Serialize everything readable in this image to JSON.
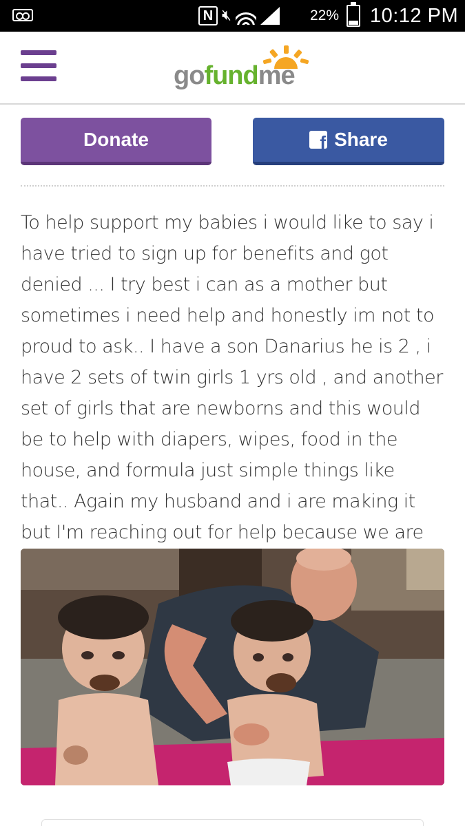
{
  "status_bar": {
    "battery_percent": "22%",
    "battery_level": 0.22,
    "time": "10:12 PM",
    "icons": [
      "voicemail-icon",
      "nfc-icon",
      "mute-icon",
      "wifi-icon",
      "signal-icon",
      "battery-charging-icon"
    ]
  },
  "header": {
    "menu_icon": "hamburger-menu-icon",
    "logo": {
      "go": "go",
      "fund": "fund",
      "me": "me"
    }
  },
  "actions": {
    "donate_label": "Donate",
    "share_label": "Share",
    "share_icon": "facebook-icon"
  },
  "story": {
    "text": "To help support my babies i would like to say i have tried to sign up for benefits and got denied ... I try best i can as a mother but sometimes i need help and honestly im not to proud to ask.. I have a son Danarius he is 2 , i have 2 sets of twin girls 1 yrs old , and another set of girls that are newborns and this would be to help with diapers, wipes, food in the house, and formula just simple things like that.. Again my husband and i are making it but I'm reaching out for help because we are not to good to ask"
  },
  "colors": {
    "brand_purple": "#7d519f",
    "facebook_blue": "#3a59a2",
    "logo_green": "#66b22e",
    "logo_gray": "#8a8a8a",
    "sun_orange": "#f5a623"
  }
}
